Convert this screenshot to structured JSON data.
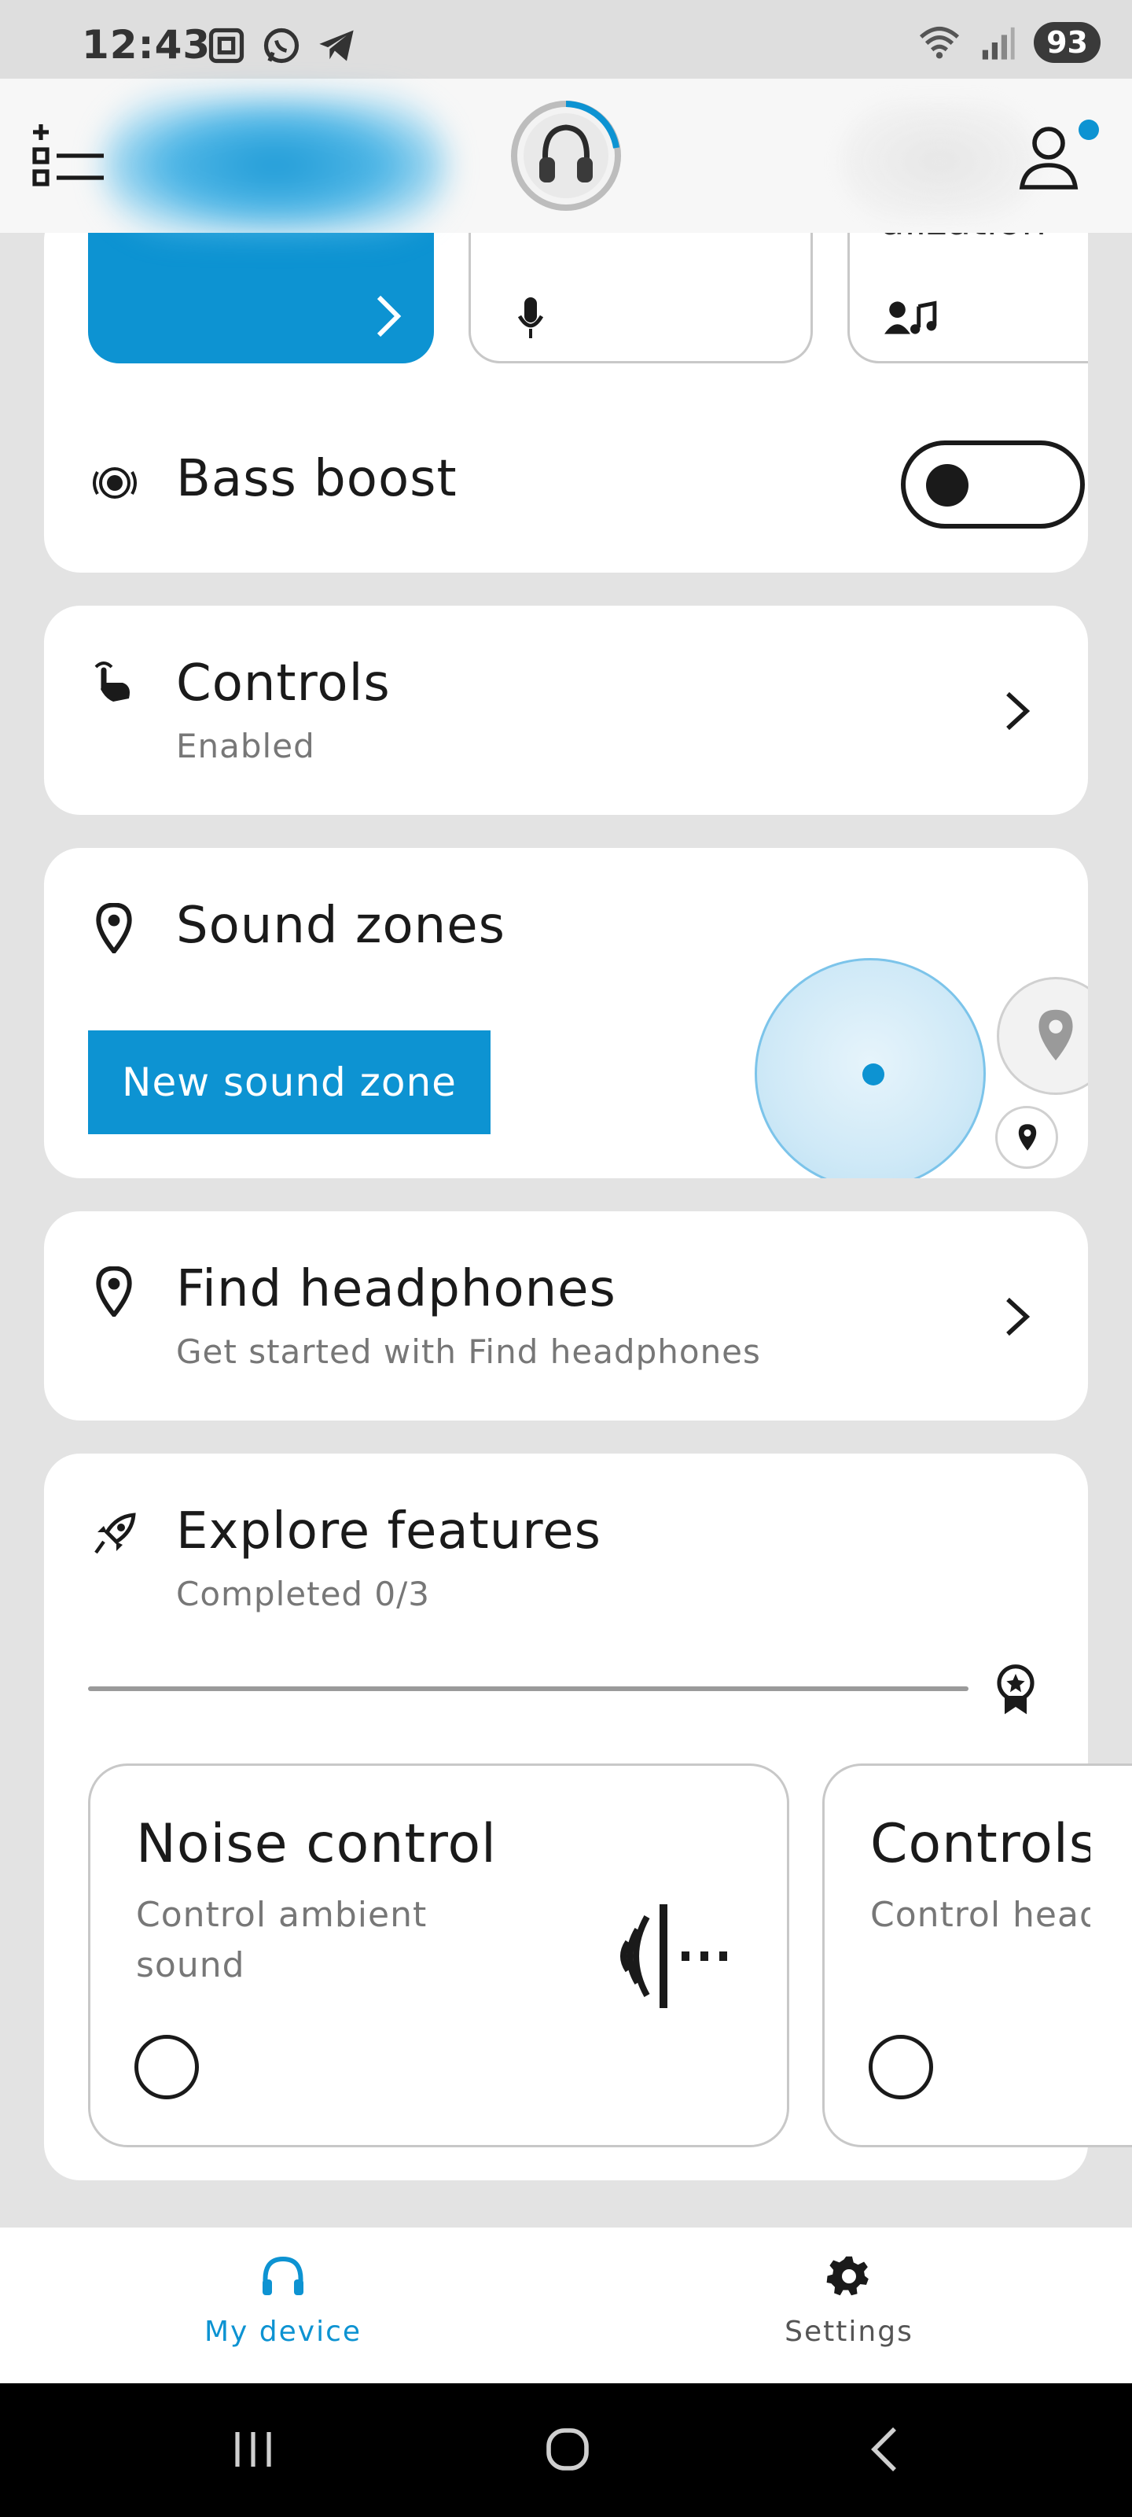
{
  "status_bar": {
    "time": "12:43",
    "battery": "93"
  },
  "header": {
    "menu_icon": "list-add-icon",
    "device_icon": "headphones-icon",
    "profile_icon": "user-icon",
    "notification": true
  },
  "tiles": {
    "partial_label": "alization",
    "icons": [
      "chevron-right-icon",
      "microphone-icon",
      "user-music-icon"
    ]
  },
  "bass_boost": {
    "label": "Bass boost",
    "enabled": false
  },
  "controls": {
    "title": "Controls",
    "subtitle": "Enabled"
  },
  "sound_zones": {
    "title": "Sound zones",
    "button": "New sound zone"
  },
  "find_headphones": {
    "title": "Find headphones",
    "subtitle": "Get started with Find headphones"
  },
  "explore": {
    "title": "Explore features",
    "subtitle": "Completed 0/3",
    "progress": 0,
    "cards": [
      {
        "title": "Noise control",
        "subtitle_line1": "Control ambient",
        "subtitle_line2": "sound"
      },
      {
        "title": "Controls",
        "subtitle_line1": "Control head"
      }
    ]
  },
  "bottom_nav": {
    "my_device": "My device",
    "settings": "Settings",
    "active": "My device"
  },
  "colors": {
    "accent": "#0d93d2",
    "background": "#e3e3e3",
    "card": "#ffffff"
  }
}
